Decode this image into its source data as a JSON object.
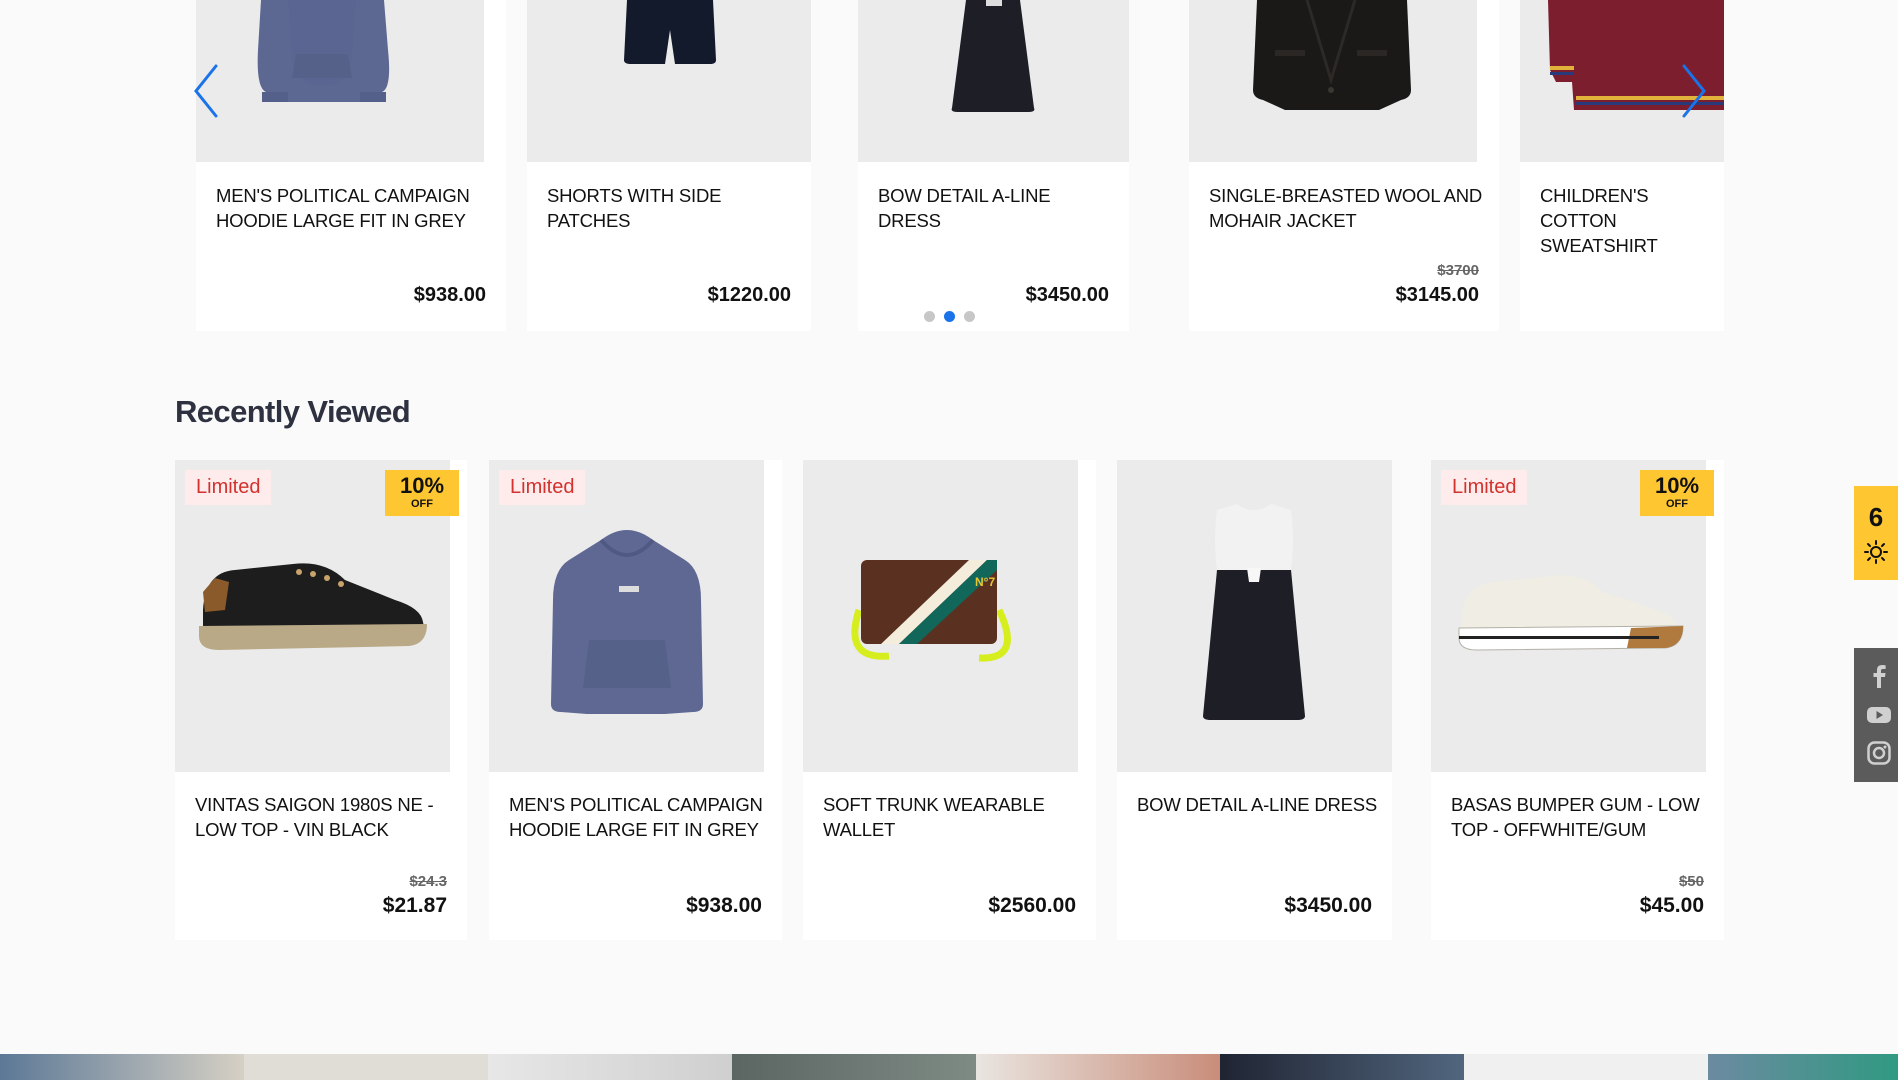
{
  "carousel": {
    "products": [
      {
        "name": "MEN'S POLITICAL CAMPAIGN HOODIE LARGE FIT IN GREY",
        "old_price": "",
        "price": "$938.00"
      },
      {
        "name": "SHORTS WITH SIDE PATCHES",
        "old_price": "",
        "price": "$1220.00"
      },
      {
        "name": "BOW DETAIL A-LINE DRESS",
        "old_price": "",
        "price": "$3450.00"
      },
      {
        "name": "SINGLE-BREASTED WOOL AND MOHAIR JACKET",
        "old_price": "$3700",
        "price": "$3145.00"
      },
      {
        "name": "CHILDREN'S COTTON SWEATSHIRT",
        "old_price": "",
        "price": ""
      }
    ],
    "active_dot": 2,
    "dot_count": 3,
    "accent_color": "#1a73e8"
  },
  "recently_viewed": {
    "title": "Recently Viewed",
    "products": [
      {
        "name": "VINTAS SAIGON 1980S NE - LOW TOP - VIN BLACK",
        "badge": "Limited",
        "discount": "10%",
        "discount_suffix": "OFF",
        "old_price": "$24.3",
        "price": "$21.87"
      },
      {
        "name": "MEN'S POLITICAL CAMPAIGN HOODIE LARGE FIT IN GREY",
        "badge": "Limited",
        "discount": "",
        "discount_suffix": "",
        "old_price": "",
        "price": "$938.00"
      },
      {
        "name": "SOFT TRUNK WEARABLE WALLET",
        "badge": "",
        "discount": "",
        "discount_suffix": "",
        "old_price": "",
        "price": "$2560.00"
      },
      {
        "name": "BOW DETAIL A-LINE DRESS",
        "badge": "",
        "discount": "",
        "discount_suffix": "",
        "old_price": "",
        "price": "$3450.00"
      },
      {
        "name": "BASAS BUMPER GUM - LOW TOP - OFFWHITE/GUM",
        "badge": "Limited",
        "discount": "10%",
        "discount_suffix": "OFF",
        "old_price": "$50",
        "price": "$45.00"
      }
    ]
  },
  "side": {
    "theme_count": "6",
    "theme_icon": "sun-icon",
    "social_icons": [
      "facebook-icon",
      "youtube-icon",
      "instagram-icon"
    ]
  },
  "colors": {
    "badge_yellow": "#fec630",
    "limited_red": "#d3312d",
    "card_image_bg": "#ebebeb"
  }
}
